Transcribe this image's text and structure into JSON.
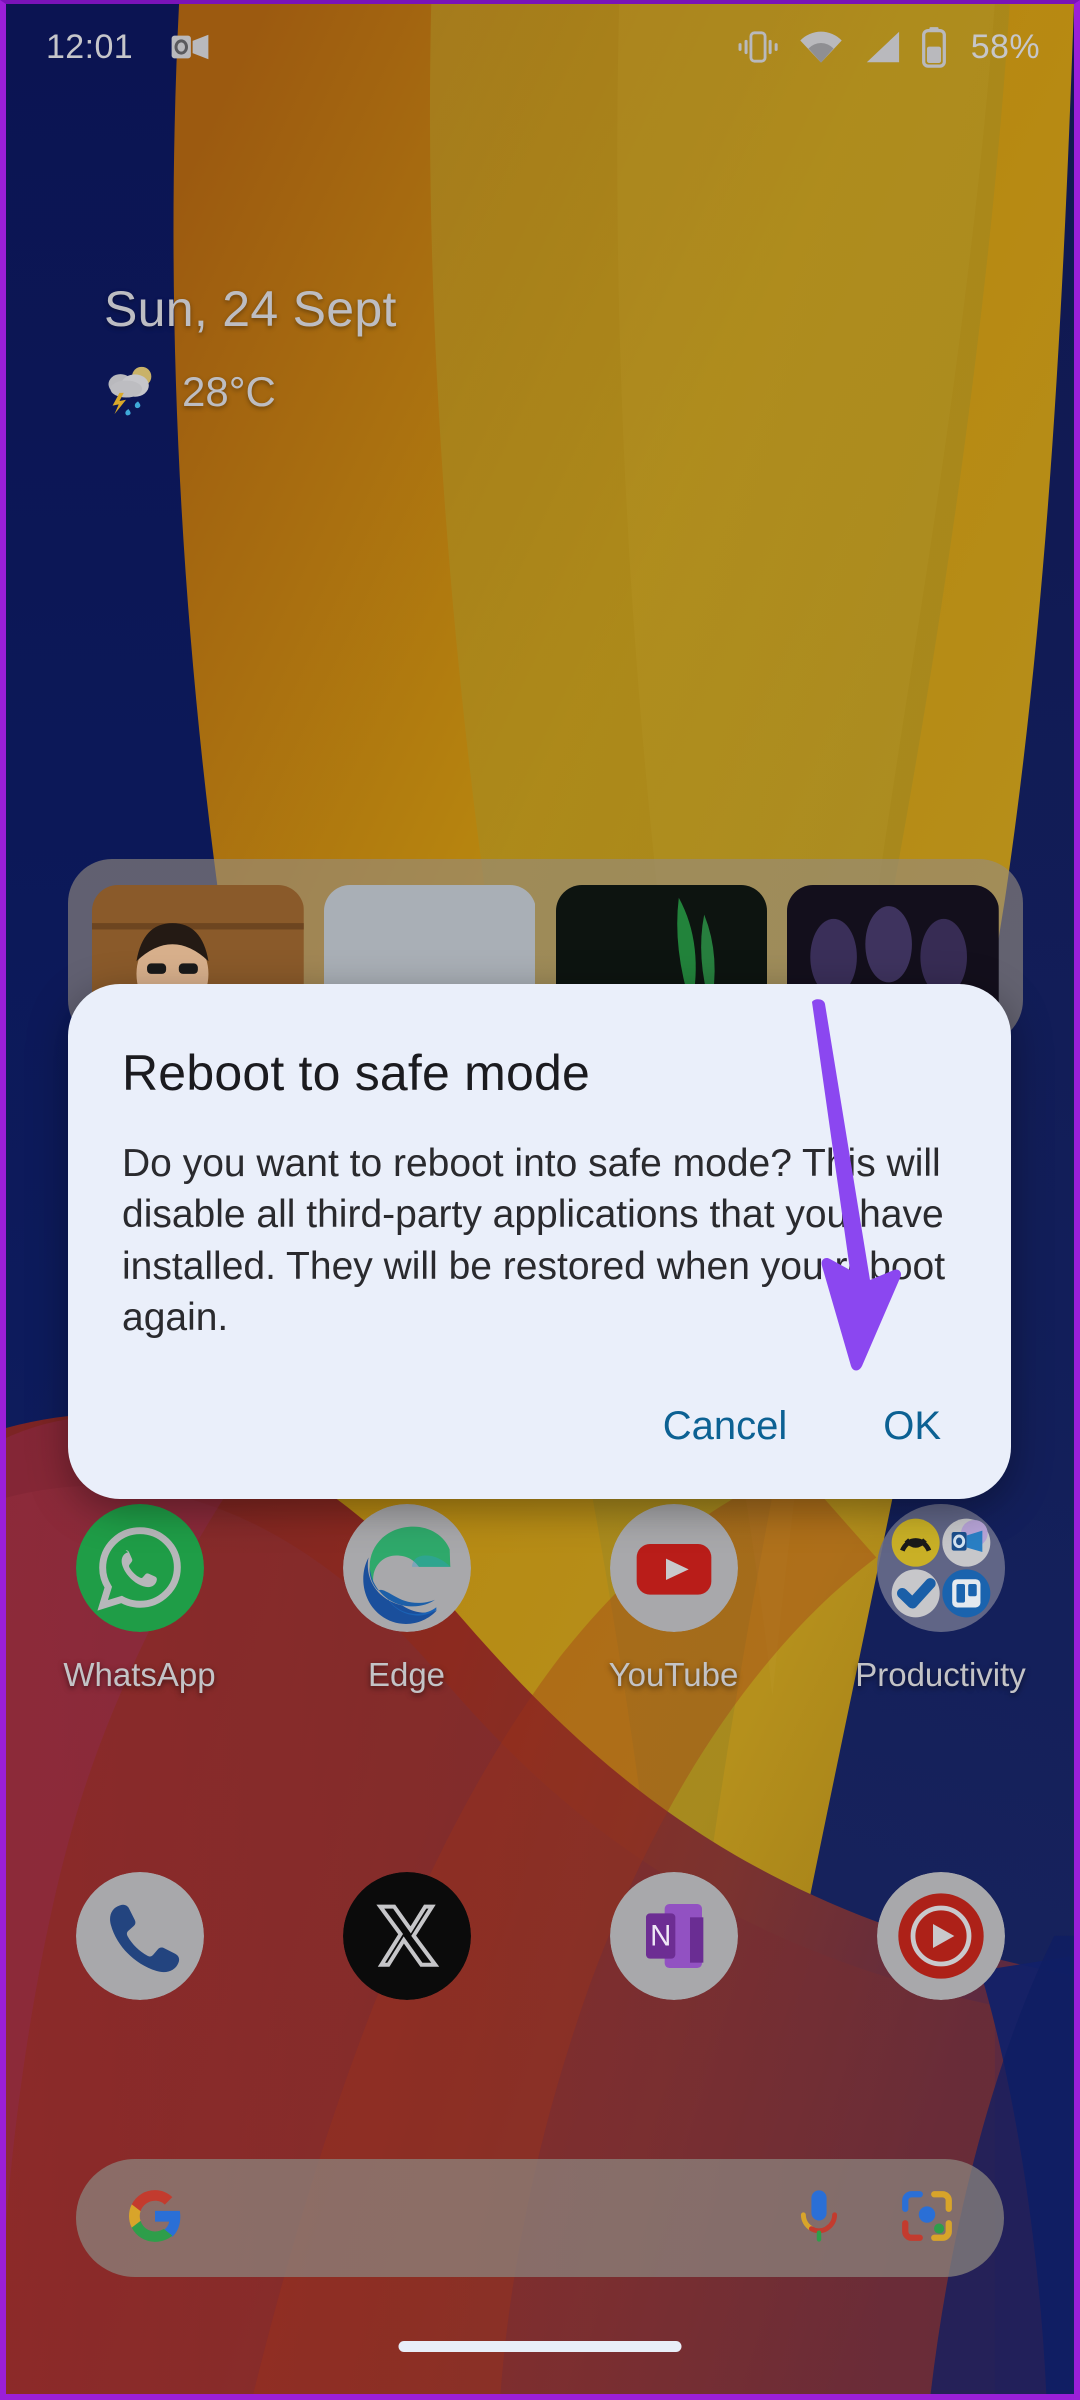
{
  "status_bar": {
    "time": "12:01",
    "battery_percent": "58%",
    "icons": [
      "outlook-notification-icon",
      "vibrate-icon",
      "wifi-icon",
      "signal-icon",
      "battery-icon"
    ]
  },
  "date_widget": {
    "date": "Sun, 24 Sept",
    "temperature": "28°C",
    "weather_icon": "thunderstorm-rain-icon"
  },
  "photos_widget": {
    "name": "photos-widget",
    "photo_count": 4
  },
  "dialog": {
    "title": "Reboot to safe mode",
    "body": "Do you want to reboot into safe mode? This will disable all third-party applications that you have installed. They will be restored when you reboot again.",
    "cancel_label": "Cancel",
    "ok_label": "OK",
    "button_color": "#0c6193",
    "background_color": "#eaeffa"
  },
  "annotation": {
    "arrow_color": "#8b47f0",
    "points_to": "OK"
  },
  "app_row": [
    {
      "label": "WhatsApp",
      "icon": "whatsapp-icon"
    },
    {
      "label": "Edge",
      "icon": "microsoft-edge-icon"
    },
    {
      "label": "YouTube",
      "icon": "youtube-icon"
    },
    {
      "label": "Productivity",
      "icon": "folder-icon"
    }
  ],
  "folder_apps": [
    "basecamp-icon",
    "outlook-icon",
    "todoist-icon",
    "trello-icon"
  ],
  "dock_row": [
    {
      "label": "",
      "icon": "phone-icon"
    },
    {
      "label": "",
      "icon": "x-twitter-icon"
    },
    {
      "label": "",
      "icon": "onenote-icon"
    },
    {
      "label": "",
      "icon": "youtube-music-icon"
    }
  ],
  "search_bar": {
    "logo": "google-g-icon",
    "mic": "microphone-icon",
    "lens": "google-lens-icon"
  },
  "navigation": {
    "home_bar": "home-gesture-bar"
  },
  "colors": {
    "wallpaper_navy": "#0c1750",
    "wallpaper_gold": "#b98a14",
    "wallpaper_red": "#7e2020",
    "frame_purple": "#9b1fd8"
  }
}
